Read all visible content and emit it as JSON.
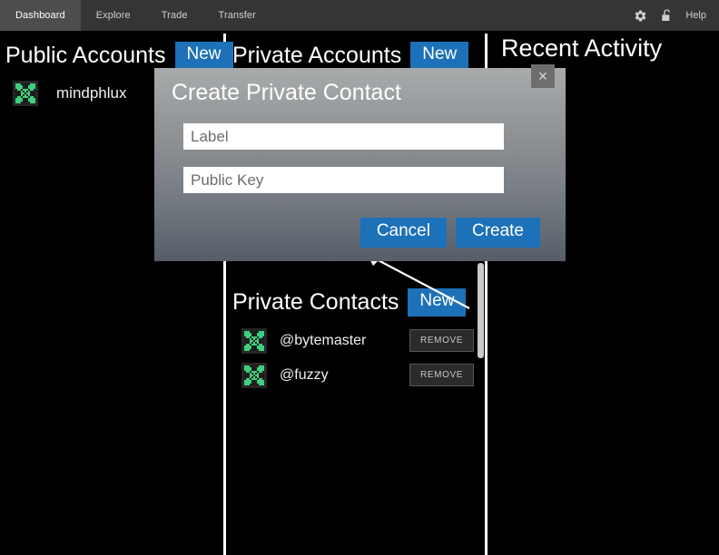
{
  "nav": {
    "tabs": [
      {
        "label": "Dashboard",
        "active": true
      },
      {
        "label": "Explore",
        "active": false
      },
      {
        "label": "Trade",
        "active": false
      },
      {
        "label": "Transfer",
        "active": false
      }
    ],
    "gear_icon": "gear-icon",
    "unlock_icon": "unlock-icon",
    "help_label": "Help"
  },
  "public_accounts": {
    "title": "Public Accounts",
    "new_label": "New",
    "accounts": [
      {
        "name": "mindphlux",
        "avatar": "identicon"
      }
    ]
  },
  "private_accounts": {
    "title": "Private Accounts",
    "new_label": "New"
  },
  "recent_activity": {
    "title": "Recent Activity"
  },
  "private_contacts": {
    "title": "Private Contacts",
    "new_label": "New",
    "remove_label": "REMOVE",
    "contacts": [
      {
        "name": "@bytemaster",
        "avatar": "identicon"
      },
      {
        "name": "@fuzzy",
        "avatar": "identicon"
      }
    ]
  },
  "modal": {
    "title": "Create Private Contact",
    "close_label": "×",
    "fields": [
      {
        "name": "label",
        "value": "",
        "placeholder": "Label"
      },
      {
        "name": "public_key",
        "value": "",
        "placeholder": "Public Key"
      }
    ],
    "cancel_label": "Cancel",
    "create_label": "Create"
  },
  "colors": {
    "accent_blue": "#1d71b8",
    "navbar": "#353535",
    "nav_active": "#4d4d4d",
    "background": "#000000",
    "identicon_green": "#3ecf7e",
    "modal_top": "#a8abac",
    "modal_bottom": "#575e68"
  }
}
